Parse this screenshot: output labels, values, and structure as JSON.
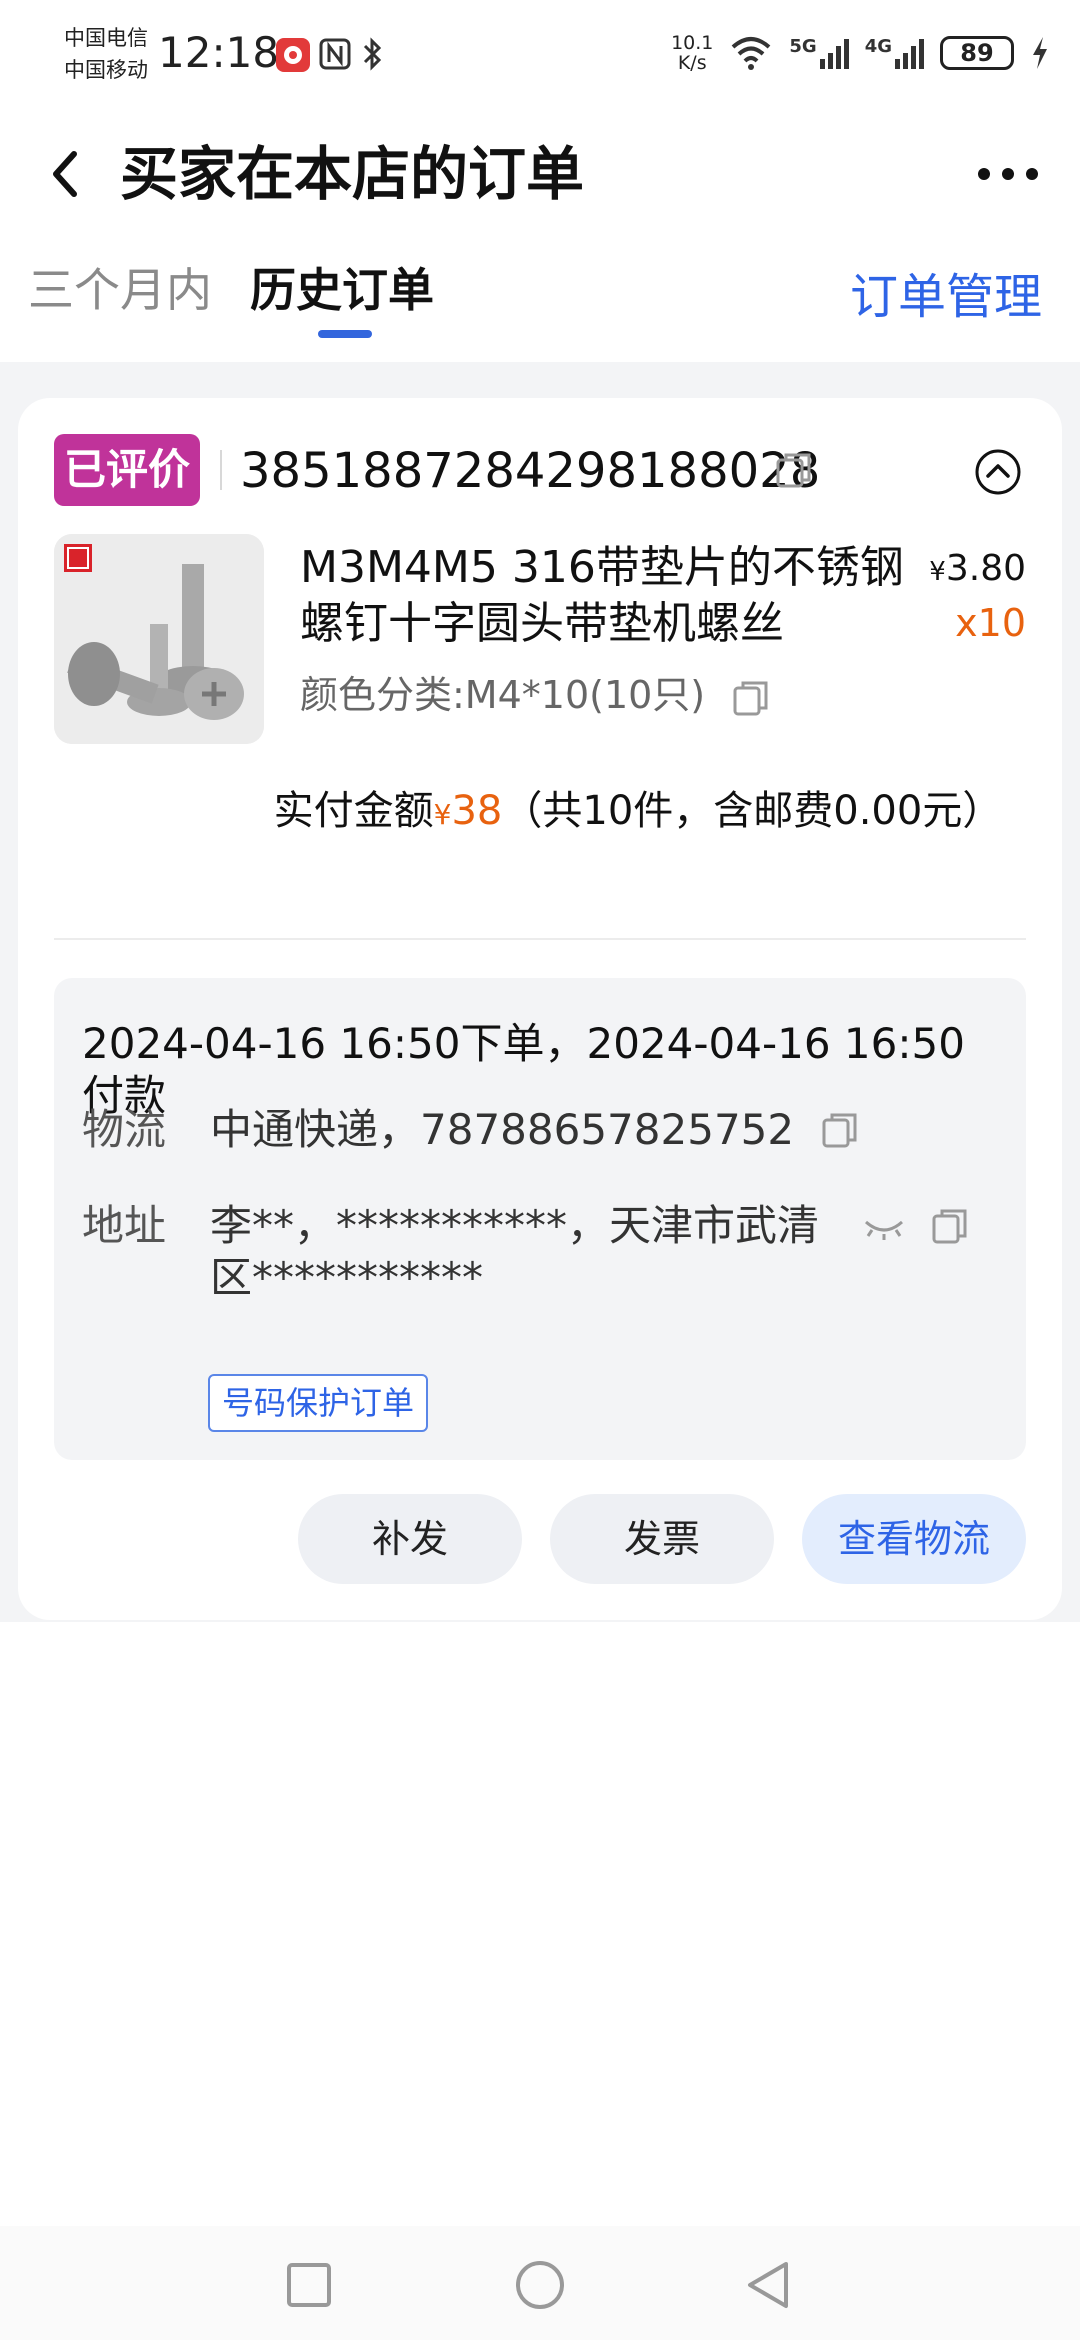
{
  "status_bar": {
    "carrier1": "中国电信",
    "carrier2": "中国移动",
    "time": "12:18",
    "net_speed_value": "10.1",
    "net_speed_unit": "K/s",
    "signal1_label": "5G",
    "signal2_label": "4G",
    "battery": "89"
  },
  "header": {
    "title": "买家在本店的订单"
  },
  "tabs": [
    {
      "label": "三个月内"
    },
    {
      "label": "历史订单"
    }
  ],
  "order_manage_label": "订单管理",
  "order": {
    "status_badge": "已评价",
    "order_number": "3851887284298188028",
    "product_title": "M3M4M5 316带垫片的不锈钢螺钉十字圆头带垫机螺丝",
    "price_symbol": "¥",
    "price": "3.80",
    "quantity": "x10",
    "spec": "颜色分类:M4*10(10只)",
    "paid_label": "实付金额",
    "paid_symbol": "¥",
    "paid_amount": "38",
    "paid_note": "（共10件，含邮费0.00元）",
    "time_info": "2024-04-16 16:50下单，2024-04-16 16:50付款",
    "logistics_label": "物流",
    "logistics_value": "中通快递，78788657825752",
    "address_label": "地址",
    "address_value": "李**，***********，天津市武清区***********",
    "protect_tag": "号码保护订单",
    "buttons": {
      "reissue": "补发",
      "invoice": "发票",
      "logistics": "查看物流"
    }
  },
  "colors": {
    "accent_blue": "#2e64e6",
    "badge_magenta": "#c0339a",
    "price_orange": "#e8620f"
  }
}
